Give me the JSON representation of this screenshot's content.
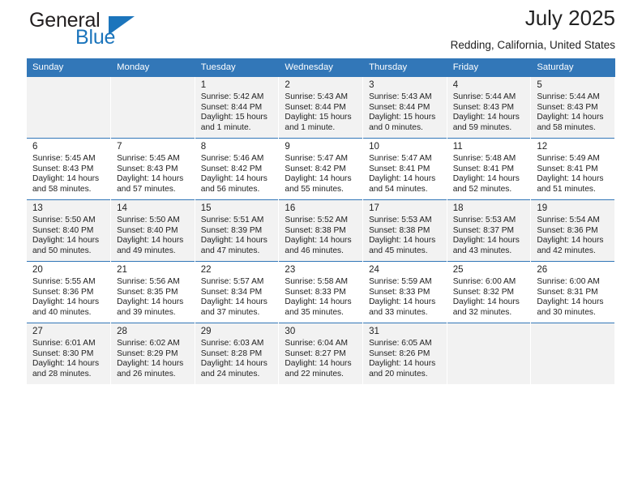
{
  "brand": {
    "name_top": "General",
    "name_bottom": "Blue",
    "triangle_color": "#1c75bc",
    "text_color": "#231f20"
  },
  "header": {
    "title": "July 2025",
    "subtitle": "Redding, California, United States"
  },
  "theme": {
    "header_bg": "#3277b8",
    "header_text": "#ffffff",
    "row_alt_bg": "#f2f2f2",
    "row_bg": "#ffffff"
  },
  "calendar": {
    "weekday_headers": [
      "Sunday",
      "Monday",
      "Tuesday",
      "Wednesday",
      "Thursday",
      "Friday",
      "Saturday"
    ],
    "weeks": [
      [
        {
          "day": "",
          "info": ""
        },
        {
          "day": "",
          "info": ""
        },
        {
          "day": "1",
          "info": "Sunrise: 5:42 AM\nSunset: 8:44 PM\nDaylight: 15 hours\nand 1 minute."
        },
        {
          "day": "2",
          "info": "Sunrise: 5:43 AM\nSunset: 8:44 PM\nDaylight: 15 hours\nand 1 minute."
        },
        {
          "day": "3",
          "info": "Sunrise: 5:43 AM\nSunset: 8:44 PM\nDaylight: 15 hours\nand 0 minutes."
        },
        {
          "day": "4",
          "info": "Sunrise: 5:44 AM\nSunset: 8:43 PM\nDaylight: 14 hours\nand 59 minutes."
        },
        {
          "day": "5",
          "info": "Sunrise: 5:44 AM\nSunset: 8:43 PM\nDaylight: 14 hours\nand 58 minutes."
        }
      ],
      [
        {
          "day": "6",
          "info": "Sunrise: 5:45 AM\nSunset: 8:43 PM\nDaylight: 14 hours\nand 58 minutes."
        },
        {
          "day": "7",
          "info": "Sunrise: 5:45 AM\nSunset: 8:43 PM\nDaylight: 14 hours\nand 57 minutes."
        },
        {
          "day": "8",
          "info": "Sunrise: 5:46 AM\nSunset: 8:42 PM\nDaylight: 14 hours\nand 56 minutes."
        },
        {
          "day": "9",
          "info": "Sunrise: 5:47 AM\nSunset: 8:42 PM\nDaylight: 14 hours\nand 55 minutes."
        },
        {
          "day": "10",
          "info": "Sunrise: 5:47 AM\nSunset: 8:41 PM\nDaylight: 14 hours\nand 54 minutes."
        },
        {
          "day": "11",
          "info": "Sunrise: 5:48 AM\nSunset: 8:41 PM\nDaylight: 14 hours\nand 52 minutes."
        },
        {
          "day": "12",
          "info": "Sunrise: 5:49 AM\nSunset: 8:41 PM\nDaylight: 14 hours\nand 51 minutes."
        }
      ],
      [
        {
          "day": "13",
          "info": "Sunrise: 5:50 AM\nSunset: 8:40 PM\nDaylight: 14 hours\nand 50 minutes."
        },
        {
          "day": "14",
          "info": "Sunrise: 5:50 AM\nSunset: 8:40 PM\nDaylight: 14 hours\nand 49 minutes."
        },
        {
          "day": "15",
          "info": "Sunrise: 5:51 AM\nSunset: 8:39 PM\nDaylight: 14 hours\nand 47 minutes."
        },
        {
          "day": "16",
          "info": "Sunrise: 5:52 AM\nSunset: 8:38 PM\nDaylight: 14 hours\nand 46 minutes."
        },
        {
          "day": "17",
          "info": "Sunrise: 5:53 AM\nSunset: 8:38 PM\nDaylight: 14 hours\nand 45 minutes."
        },
        {
          "day": "18",
          "info": "Sunrise: 5:53 AM\nSunset: 8:37 PM\nDaylight: 14 hours\nand 43 minutes."
        },
        {
          "day": "19",
          "info": "Sunrise: 5:54 AM\nSunset: 8:36 PM\nDaylight: 14 hours\nand 42 minutes."
        }
      ],
      [
        {
          "day": "20",
          "info": "Sunrise: 5:55 AM\nSunset: 8:36 PM\nDaylight: 14 hours\nand 40 minutes."
        },
        {
          "day": "21",
          "info": "Sunrise: 5:56 AM\nSunset: 8:35 PM\nDaylight: 14 hours\nand 39 minutes."
        },
        {
          "day": "22",
          "info": "Sunrise: 5:57 AM\nSunset: 8:34 PM\nDaylight: 14 hours\nand 37 minutes."
        },
        {
          "day": "23",
          "info": "Sunrise: 5:58 AM\nSunset: 8:33 PM\nDaylight: 14 hours\nand 35 minutes."
        },
        {
          "day": "24",
          "info": "Sunrise: 5:59 AM\nSunset: 8:33 PM\nDaylight: 14 hours\nand 33 minutes."
        },
        {
          "day": "25",
          "info": "Sunrise: 6:00 AM\nSunset: 8:32 PM\nDaylight: 14 hours\nand 32 minutes."
        },
        {
          "day": "26",
          "info": "Sunrise: 6:00 AM\nSunset: 8:31 PM\nDaylight: 14 hours\nand 30 minutes."
        }
      ],
      [
        {
          "day": "27",
          "info": "Sunrise: 6:01 AM\nSunset: 8:30 PM\nDaylight: 14 hours\nand 28 minutes."
        },
        {
          "day": "28",
          "info": "Sunrise: 6:02 AM\nSunset: 8:29 PM\nDaylight: 14 hours\nand 26 minutes."
        },
        {
          "day": "29",
          "info": "Sunrise: 6:03 AM\nSunset: 8:28 PM\nDaylight: 14 hours\nand 24 minutes."
        },
        {
          "day": "30",
          "info": "Sunrise: 6:04 AM\nSunset: 8:27 PM\nDaylight: 14 hours\nand 22 minutes."
        },
        {
          "day": "31",
          "info": "Sunrise: 6:05 AM\nSunset: 8:26 PM\nDaylight: 14 hours\nand 20 minutes."
        },
        {
          "day": "",
          "info": ""
        },
        {
          "day": "",
          "info": ""
        }
      ]
    ]
  }
}
